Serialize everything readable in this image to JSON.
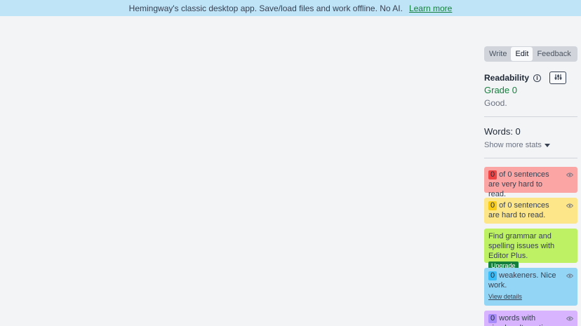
{
  "banner": {
    "text": "Hemingway's classic desktop app. Save/load files and work offline. No AI.",
    "link": "Learn more"
  },
  "modes": {
    "write": "Write",
    "edit": "Edit",
    "feedback": "Feedback",
    "active": "Edit"
  },
  "readability": {
    "title": "Readability",
    "grade": "Grade 0",
    "description": "Good."
  },
  "stats": {
    "words": "Words: 0",
    "more": "Show more stats"
  },
  "cards": {
    "very_hard": {
      "count": "0",
      "text": "of 0 sentences are very hard to read.",
      "color": "#fca5a5"
    },
    "hard": {
      "count": "0",
      "text": "of 0 sentences are hard to read.",
      "color": "#fde68a"
    },
    "upgrade": {
      "text": "Find grammar and spelling issues with Editor Plus.",
      "button": "Upgrade",
      "color": "#bef264"
    },
    "weakeners": {
      "count": "0",
      "text": "weakeners. Nice work.",
      "link": "View details",
      "color": "#93d5f5"
    },
    "simpler": {
      "count": "0",
      "text": "words with simpler alternatives.",
      "color": "#d8b4fe"
    }
  },
  "icons": {
    "info": "info-icon",
    "settings": "sliders-icon",
    "eye": "eye-icon",
    "caret": "caret-down-icon"
  }
}
